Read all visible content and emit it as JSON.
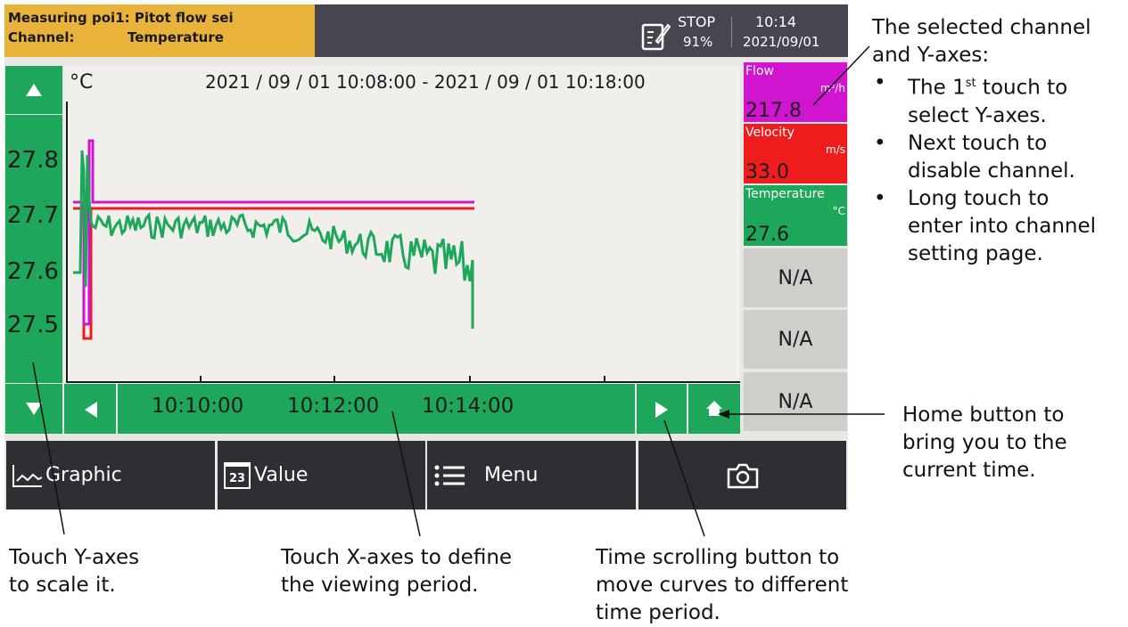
{
  "status": {
    "measuring_point_key": "Measuring poi",
    "measuring_point_value": "1: Pitot flow sei",
    "channel_key": "Channel:",
    "channel_value": "Temperature",
    "record_state": "STOP",
    "memory": "91%",
    "time": "10:14",
    "date": "2021/09/01"
  },
  "plot": {
    "unit": "°C",
    "range": "2021 / 09 / 01 10:08:00 - 2021 / 09 / 01 10:18:00",
    "y_ticks": [
      "27.8",
      "27.7",
      "27.6",
      "27.5"
    ],
    "x_ticks": [
      "10:10:00",
      "10:12:00",
      "10:14:00"
    ]
  },
  "channels": [
    {
      "name": "Flow",
      "unit": "m³/h",
      "value": "217.8",
      "color": "#d014cf"
    },
    {
      "name": "Velocity",
      "unit": "m/s",
      "value": "33.0",
      "color": "#ee1c1c"
    },
    {
      "name": "Temperature",
      "unit": "°C",
      "value": "27.6",
      "color": "#1ea75a"
    }
  ],
  "empty_slots": [
    "N/A",
    "N/A",
    "N/A"
  ],
  "bottom_nav": {
    "graphic": "Graphic",
    "value_icon": "23",
    "value": "Value",
    "menu": "Menu"
  },
  "annotations": {
    "channel_title_1": "The selected channel",
    "channel_title_2": "and Y-axes:",
    "bullet_1a_pre": "The 1",
    "bullet_1a_sup": "st",
    "bullet_1a_post": " touch to",
    "bullet_1b": "select Y-axes.",
    "bullet_2a": "Next touch to",
    "bullet_2b": "disable channel.",
    "bullet_3a": "Long touch to",
    "bullet_3b": "enter into channel",
    "bullet_3c": "setting page.",
    "home_1": "Home button to",
    "home_2": "bring you to the",
    "home_3": "current time.",
    "yaxes_1": "Touch Y-axes",
    "yaxes_2": "to scale it.",
    "xaxes_1": "Touch X-axes to define",
    "xaxes_2": "the viewing period.",
    "scroll_1": "Time scrolling button to",
    "scroll_2": "move curves to different",
    "scroll_3": "time period."
  },
  "icons": [
    "record-icon",
    "up-arrow-icon",
    "down-arrow-icon",
    "left-arrow-icon",
    "right-arrow-icon",
    "home-icon",
    "graphic-icon",
    "value-icon",
    "menu-icon",
    "camera-icon"
  ]
}
